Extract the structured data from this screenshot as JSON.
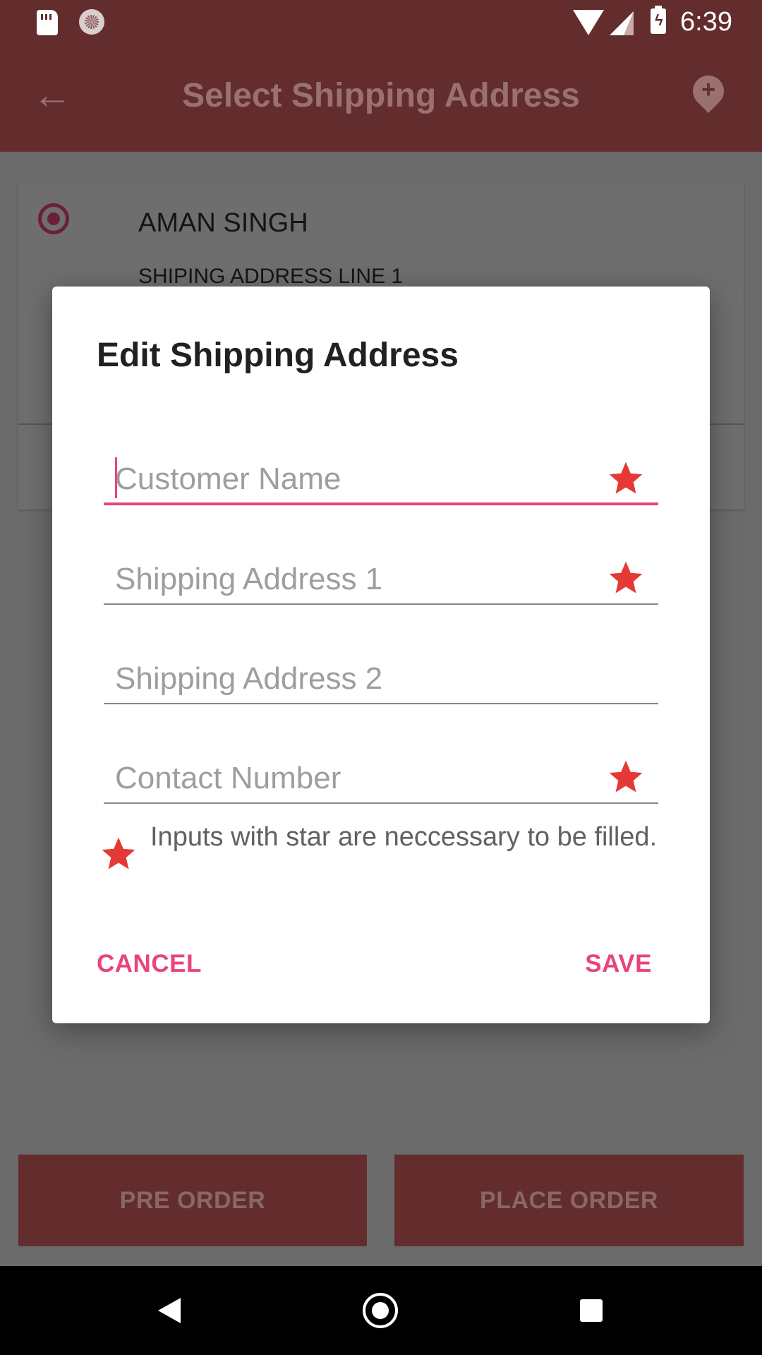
{
  "status_bar": {
    "time": "6:39",
    "battery_glyph": "ϟ"
  },
  "app_bar": {
    "back_glyph": "←",
    "title": "Select Shipping Address",
    "pin_glyph": "+"
  },
  "address_card": {
    "name": "AMAN SINGH",
    "address_line_1": "SHIPING ADDRESS LINE 1"
  },
  "bottom_buttons": {
    "pre_order": "PRE ORDER",
    "place_order": "PLACE ORDER"
  },
  "dialog": {
    "title": "Edit Shipping Address",
    "fields": {
      "customer_name": {
        "placeholder": "Customer Name",
        "value": ""
      },
      "address_1": {
        "placeholder": "Shipping Address 1",
        "value": ""
      },
      "address_2": {
        "placeholder": "Shipping Address 2",
        "value": ""
      },
      "contact_number": {
        "placeholder": "Contact Number",
        "value": ""
      }
    },
    "note": "Inputs with star are neccessary to be filled.",
    "cancel_label": "CANCEL",
    "save_label": "SAVE"
  },
  "colors": {
    "app_bar": "#632d2d",
    "accent": "#e8467a",
    "required_star": "#e53935"
  }
}
